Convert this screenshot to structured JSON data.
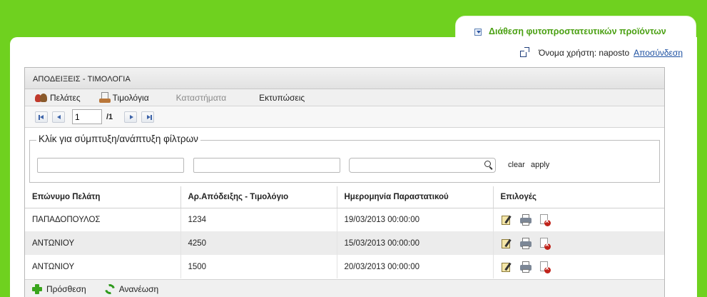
{
  "app": {
    "title": "Διάθεση φυτοπροστατευτικών προϊόντων"
  },
  "user": {
    "label": "Όνομα χρήστη: naposto",
    "logout": "Αποσύνδεση"
  },
  "grid": {
    "title": "ΑΠΟΔΕΙΞΕΙΣ - ΤΙΜΟΛΟΓΙΑ",
    "menu": {
      "customers": "Πελάτες",
      "invoices": "Τιμολόγια",
      "stores": "Καταστήματα",
      "prints": "Εκτυπώσεις"
    },
    "pager": {
      "page": "1",
      "total": "/1"
    },
    "filter": {
      "legend": "Κλίκ για σύμπτυξη/ανάπτυξη φίλτρων",
      "clear": "clear",
      "apply": "apply"
    },
    "columns": [
      "Επώνυμο Πελάτη",
      "Αρ.Απόδειξης - Τιμολόγιο",
      "Ημερομηνία Παραστατικού",
      "Επιλογές"
    ],
    "rows": [
      {
        "name": "ΠΑΠΑΔΟΠΟΥΛΟΣ",
        "number": "1234",
        "date": "19/03/2013 00:00:00"
      },
      {
        "name": "ΑΝΤΩΝΙΟΥ",
        "number": "4250",
        "date": "15/03/2013 00:00:00"
      },
      {
        "name": "ΑΝΤΩΝΙΟΥ",
        "number": "1500",
        "date": "20/03/2013 00:00:00"
      }
    ],
    "footer": {
      "add": "Πρόσθεση",
      "refresh": "Ανανέωση"
    }
  },
  "colors": {
    "background": "#6fd11f",
    "title_green": "#4aa012",
    "link_blue": "#1a4ea0"
  },
  "icons": [
    "chevron-down-icon",
    "external-link-icon",
    "customers-icon",
    "invoices-icon",
    "search-icon",
    "edit-icon",
    "print-icon",
    "delete-icon",
    "plus-icon",
    "refresh-icon"
  ]
}
